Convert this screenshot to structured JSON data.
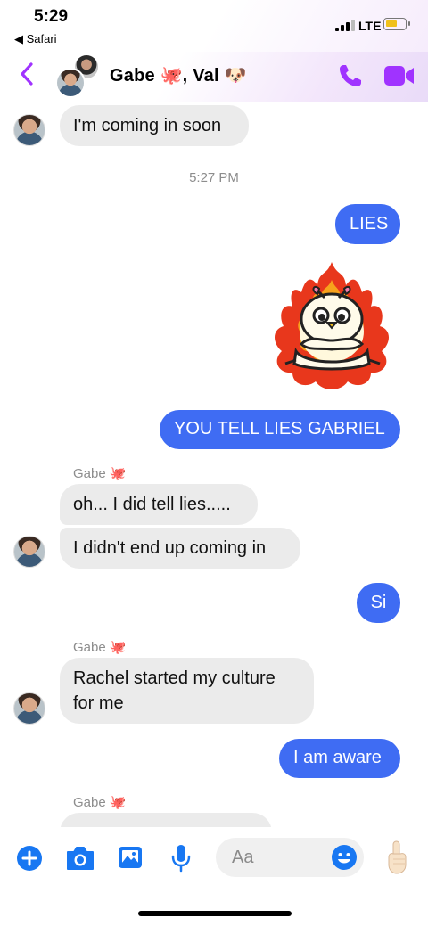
{
  "status": {
    "time": "5:29",
    "back_app": "◀ Safari",
    "network": "LTE"
  },
  "header": {
    "title": "Gabe 🐙, Val 🐶"
  },
  "messages": {
    "m1": "I'm coming in soon",
    "timestamp": "5:27 PM",
    "m2": "LIES",
    "m3": "YOU TELL LIES GABRIEL",
    "sender1": "Gabe 🐙",
    "m4": "oh... I did tell lies.....",
    "m5": "I didn't end up coming in",
    "m6": "Si",
    "sender2": "Gabe 🐙",
    "m7a": "Rachel started my culture",
    "m7b": "for me",
    "m8": "I am aware",
    "sender3": "Gabe 🐙"
  },
  "composer": {
    "placeholder": "Aa",
    "icons": [
      "plus-icon",
      "camera-icon",
      "image-icon",
      "microphone-icon",
      "emoji-icon",
      "hand-pointing-up-icon"
    ]
  },
  "colors": {
    "accent": "#a033ff",
    "outgoing_bubble": "#3f6cf3",
    "incoming_bubble": "#ebebeb",
    "composer_blue": "#1877f2"
  }
}
